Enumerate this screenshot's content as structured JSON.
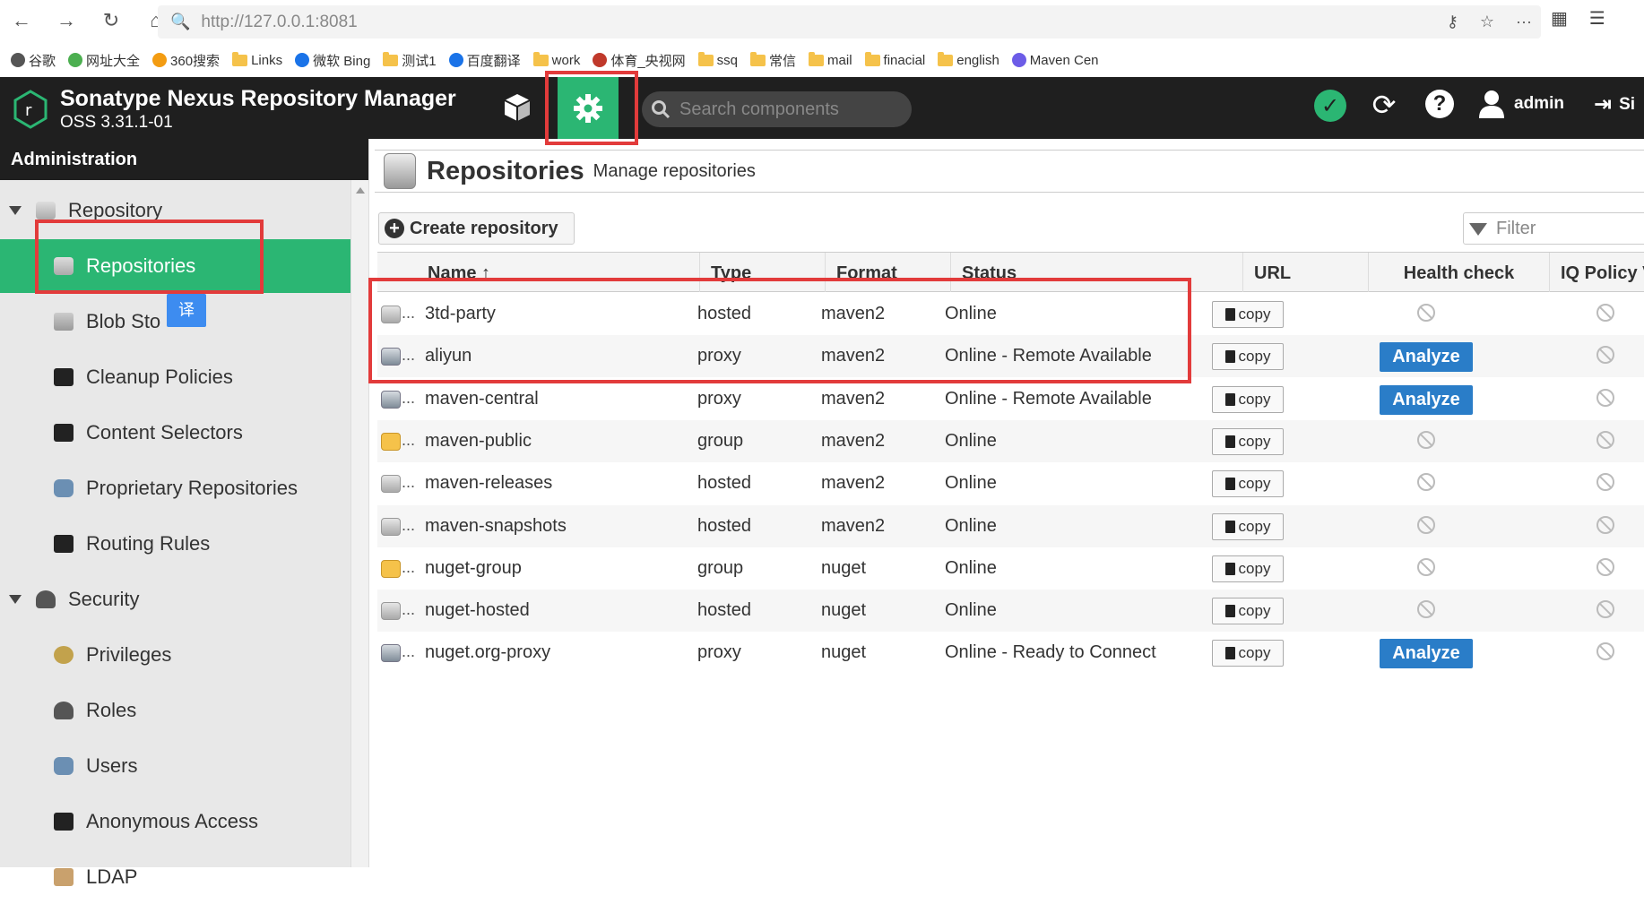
{
  "browser": {
    "url": "http://127.0.0.1:8081",
    "bookmarks": [
      "谷歌",
      "网址大全",
      "360搜索",
      "Links",
      "微软 Bing",
      "测试1",
      "百度翻译",
      "work",
      "体育_央视网",
      "ssq",
      "常信",
      "mail",
      "finacial",
      "english",
      "Maven Cen"
    ]
  },
  "header": {
    "title": "Sonatype Nexus Repository Manager",
    "version": "OSS 3.31.1-01",
    "search_placeholder": "Search components",
    "user": "admin",
    "signout": "Si"
  },
  "sidebar": {
    "heading": "Administration",
    "translate_badge": "译",
    "items": [
      {
        "label": "Repository",
        "level": "group",
        "icon": "database-icon"
      },
      {
        "label": "Repositories",
        "level": "child",
        "icon": "database-icon",
        "selected": true
      },
      {
        "label": "Blob Sto",
        "level": "child",
        "icon": "blob-store-icon"
      },
      {
        "label": "Cleanup Policies",
        "level": "child",
        "icon": "broom-icon"
      },
      {
        "label": "Content Selectors",
        "level": "child",
        "icon": "layers-icon"
      },
      {
        "label": "Proprietary Repositories",
        "level": "child",
        "icon": "shield-icon"
      },
      {
        "label": "Routing Rules",
        "level": "child",
        "icon": "signpost-icon"
      },
      {
        "label": "Security",
        "level": "group",
        "icon": "security-icon"
      },
      {
        "label": "Privileges",
        "level": "child",
        "icon": "medal-icon"
      },
      {
        "label": "Roles",
        "level": "child",
        "icon": "role-icon"
      },
      {
        "label": "Users",
        "level": "child",
        "icon": "users-icon"
      },
      {
        "label": "Anonymous Access",
        "level": "child",
        "icon": "person-icon"
      },
      {
        "label": "LDAP",
        "level": "child",
        "icon": "ldap-icon"
      }
    ]
  },
  "page": {
    "title": "Repositories",
    "subtitle": "Manage repositories",
    "create_label": "Create repository",
    "filter_placeholder": "Filter"
  },
  "table": {
    "columns": [
      "Name ↑",
      "Type",
      "Format",
      "Status",
      "URL",
      "Health check",
      "IQ Policy V"
    ],
    "copy_label": "copy",
    "analyze_label": "Analyze",
    "rows": [
      {
        "name": "3td-party",
        "type": "hosted",
        "format": "maven2",
        "status": "Online",
        "analyze": false
      },
      {
        "name": "aliyun",
        "type": "proxy",
        "format": "maven2",
        "status": "Online - Remote Available",
        "analyze": true
      },
      {
        "name": "maven-central",
        "type": "proxy",
        "format": "maven2",
        "status": "Online - Remote Available",
        "analyze": true
      },
      {
        "name": "maven-public",
        "type": "group",
        "format": "maven2",
        "status": "Online",
        "analyze": false
      },
      {
        "name": "maven-releases",
        "type": "hosted",
        "format": "maven2",
        "status": "Online",
        "analyze": false
      },
      {
        "name": "maven-snapshots",
        "type": "hosted",
        "format": "maven2",
        "status": "Online",
        "analyze": false
      },
      {
        "name": "nuget-group",
        "type": "group",
        "format": "nuget",
        "status": "Online",
        "analyze": false
      },
      {
        "name": "nuget-hosted",
        "type": "hosted",
        "format": "nuget",
        "status": "Online",
        "analyze": false
      },
      {
        "name": "nuget.org-proxy",
        "type": "proxy",
        "format": "nuget",
        "status": "Online - Ready to Connect",
        "analyze": true
      }
    ]
  }
}
